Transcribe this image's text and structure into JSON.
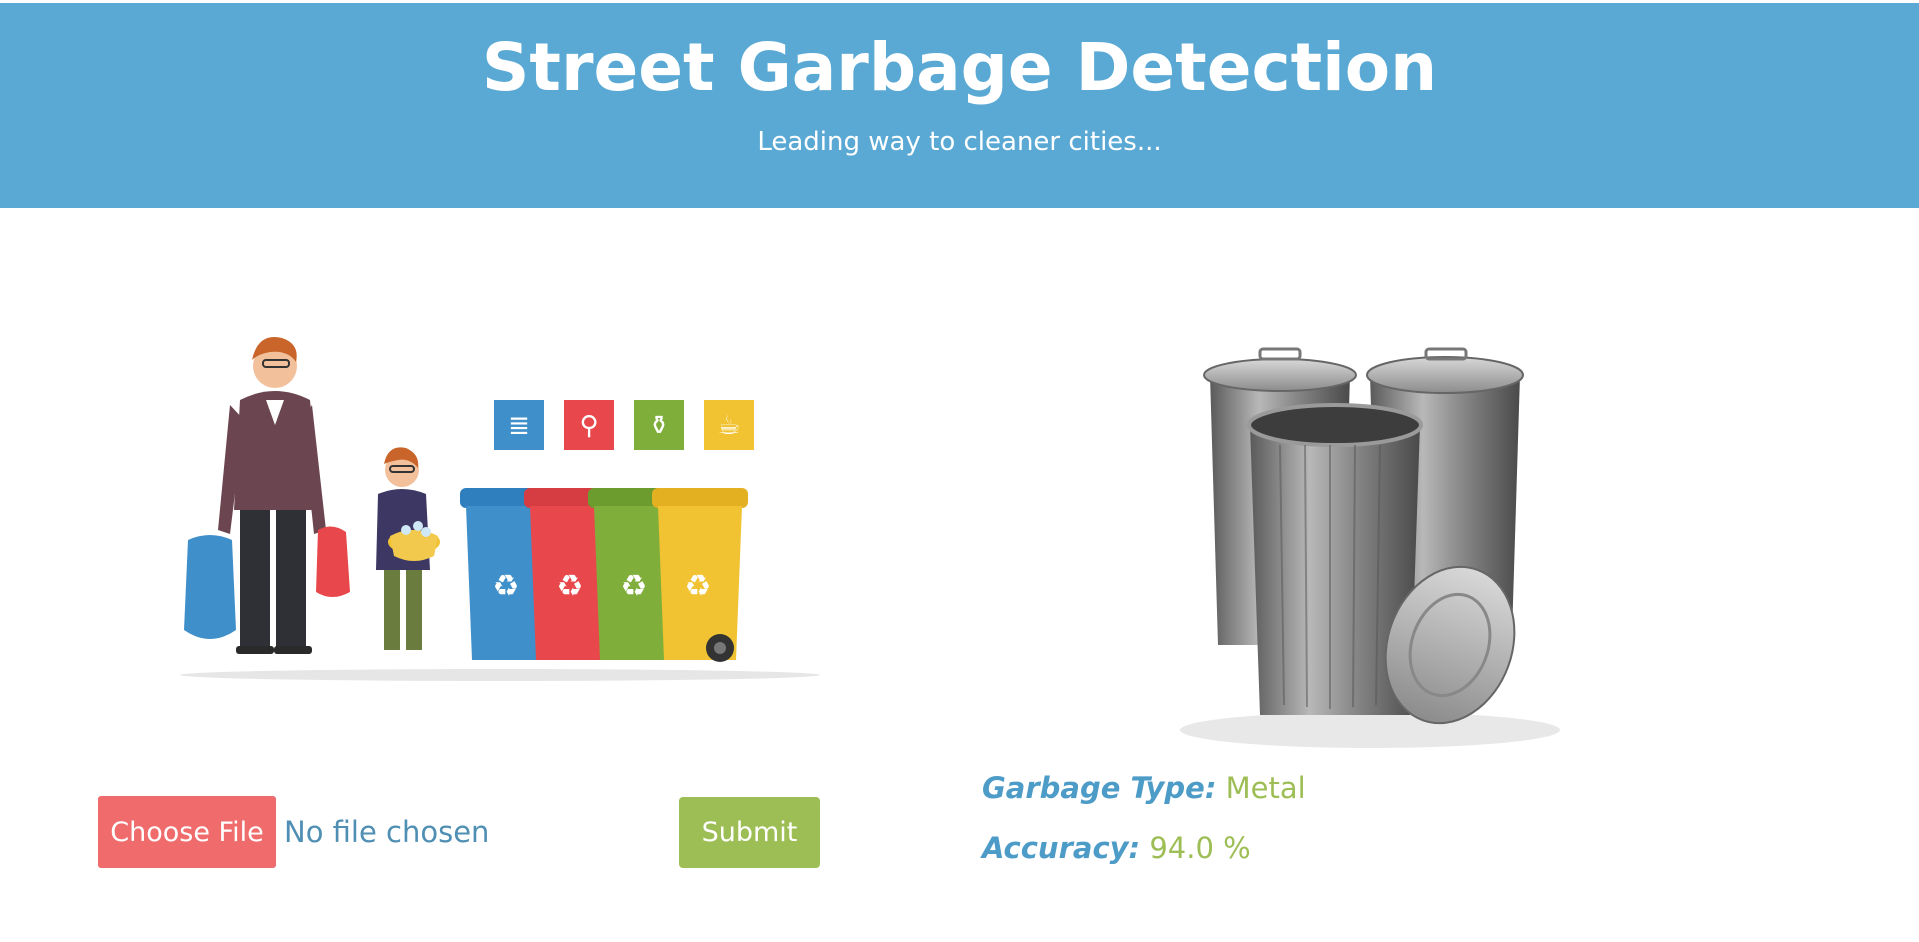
{
  "header": {
    "title": "Street Garbage Detection",
    "subtitle": "Leading way to cleaner cities..."
  },
  "upload": {
    "choose_label": "Choose File",
    "file_status": "No file chosen",
    "submit_label": "Submit"
  },
  "result": {
    "type_label": "Garbage Type:",
    "type_value": "Metal",
    "accuracy_label": "Accuracy:",
    "accuracy_value": "94.0 %"
  },
  "colors": {
    "header_bg": "#5aa9d4",
    "choose_button": "#f06b6b",
    "submit_button": "#9dbe55",
    "label_blue": "#4d9bc7",
    "value_green": "#9dbe55"
  },
  "icons": [
    "recycle-icon",
    "paper-icon",
    "screw-icon",
    "bottle-icon",
    "cup-icon"
  ]
}
